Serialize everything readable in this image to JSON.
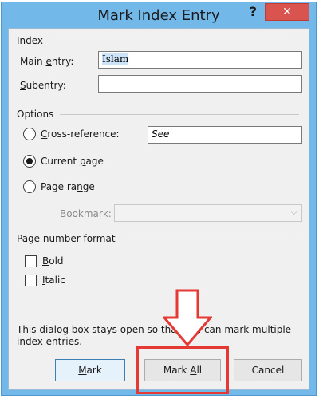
{
  "window": {
    "title": "Mark Index Entry",
    "help_label": "?",
    "close_label": "✕"
  },
  "index": {
    "group_label": "Index",
    "main_entry_label": "Main entry:",
    "main_entry_value": "Islam",
    "subentry_label": "Subentry:",
    "subentry_value": ""
  },
  "options": {
    "group_label": "Options",
    "cross_reference_label": "Cross-reference:",
    "cross_reference_value": "See",
    "current_page_label": "Current page",
    "page_range_label": "Page range",
    "bookmark_label": "Bookmark:",
    "bookmark_value": "",
    "selected": "current_page"
  },
  "page_number_format": {
    "group_label": "Page number format",
    "bold_label": "Bold",
    "italic_label": "Italic",
    "bold_checked": false,
    "italic_checked": false
  },
  "info_text": "This dialog box stays open so that you can mark multiple index entries.",
  "buttons": {
    "mark_label": "Mark",
    "mark_all_label": "Mark All",
    "cancel_label": "Cancel"
  },
  "annotation": {
    "highlight_color": "#e53935"
  }
}
